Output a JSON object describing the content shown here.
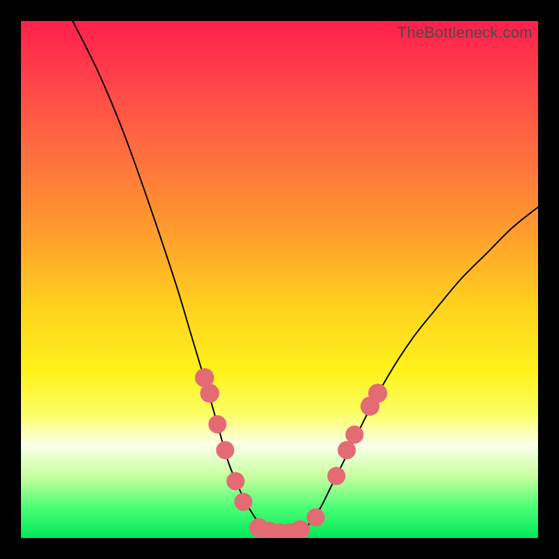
{
  "watermark": "TheBottleneck.com",
  "colors": {
    "frame_bg": "#000000",
    "curve": "#000000",
    "marker": "#e46a74",
    "gradient_stops": [
      "#ff1f4b",
      "#ff3e4b",
      "#ff6d3f",
      "#ff9a2e",
      "#ffd11e",
      "#fff31c",
      "#fcff66",
      "#fbffe9",
      "#c8ffa0",
      "#4dff75",
      "#00e859"
    ]
  },
  "chart_data": {
    "type": "line",
    "title": "",
    "xlabel": "",
    "ylabel": "",
    "xlim": [
      0,
      100
    ],
    "ylim": [
      0,
      100
    ],
    "curve": {
      "x": [
        10,
        15,
        20,
        25,
        30,
        33,
        36,
        38,
        40,
        42,
        44,
        46,
        48,
        50,
        52,
        54,
        56,
        58,
        60,
        64,
        68,
        72,
        76,
        80,
        85,
        90,
        95,
        100
      ],
      "y": [
        100,
        90,
        78,
        64,
        49,
        39,
        29,
        22,
        15,
        10,
        6,
        3,
        1.5,
        1,
        1,
        1.5,
        3,
        6,
        10,
        18,
        26,
        33,
        39,
        44,
        50,
        55,
        60,
        64
      ]
    },
    "markers": [
      {
        "x": 35.5,
        "y": 31,
        "r": 1.3
      },
      {
        "x": 36.5,
        "y": 28,
        "r": 1.3
      },
      {
        "x": 38.0,
        "y": 22,
        "r": 1.2
      },
      {
        "x": 39.5,
        "y": 17,
        "r": 1.2
      },
      {
        "x": 41.5,
        "y": 11,
        "r": 1.2
      },
      {
        "x": 43.0,
        "y": 7,
        "r": 1.2
      },
      {
        "x": 46.0,
        "y": 2,
        "r": 1.3
      },
      {
        "x": 48.0,
        "y": 1.3,
        "r": 1.3
      },
      {
        "x": 50.0,
        "y": 1,
        "r": 1.3
      },
      {
        "x": 52.0,
        "y": 1,
        "r": 1.3
      },
      {
        "x": 54.0,
        "y": 1.6,
        "r": 1.3
      },
      {
        "x": 57.0,
        "y": 4,
        "r": 1.2
      },
      {
        "x": 61.0,
        "y": 12,
        "r": 1.2
      },
      {
        "x": 63.0,
        "y": 17,
        "r": 1.2
      },
      {
        "x": 64.5,
        "y": 20,
        "r": 1.2
      },
      {
        "x": 67.5,
        "y": 25.5,
        "r": 1.3
      },
      {
        "x": 69.0,
        "y": 28,
        "r": 1.3
      }
    ]
  }
}
